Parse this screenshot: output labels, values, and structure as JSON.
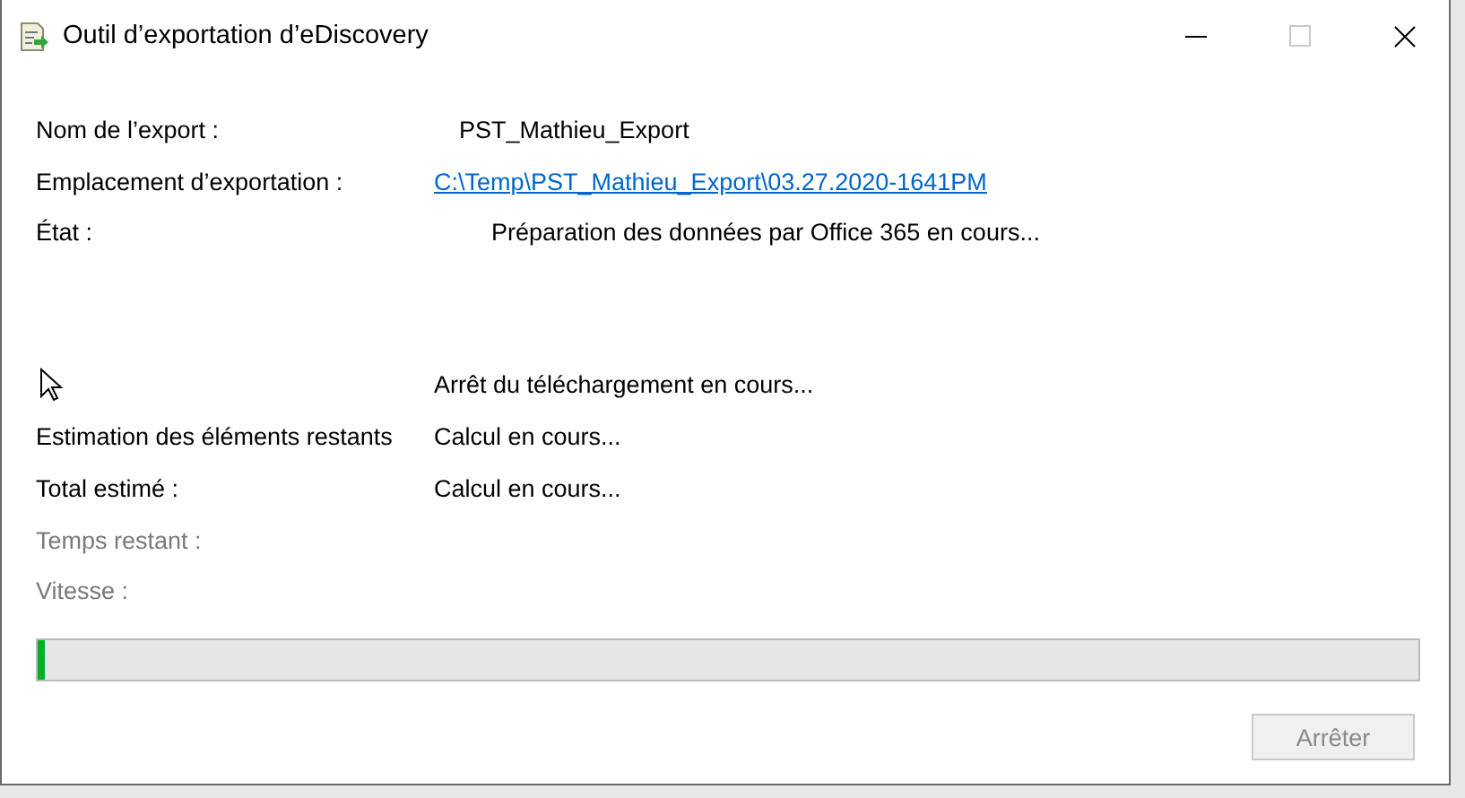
{
  "window": {
    "title": "Outil d’exportation d’eDiscovery"
  },
  "details": [
    {
      "label": "Nom de l’export :",
      "value": "PST_Mathieu_Export",
      "kind": "text"
    },
    {
      "label": "Emplacement d’exportation :",
      "value": "C:\\Temp\\PST_Mathieu_Export\\03.27.2020-1641PM",
      "kind": "link"
    },
    {
      "label": "État :",
      "value": "Préparation des données par Office 365 en cours...",
      "kind": "status"
    }
  ],
  "message": "Arrêt du téléchargement en cours...",
  "metrics": [
    {
      "label": "Estimation des éléments restants",
      "value": "Calcul en cours...",
      "disabled": false
    },
    {
      "label": "Total estimé :",
      "value": "Calcul en cours...",
      "disabled": false
    },
    {
      "label": "Temps restant :",
      "disabled": true
    },
    {
      "label": "Vitesse :",
      "disabled": true
    }
  ],
  "progress": {
    "level": 0.005
  },
  "stop_button": {
    "label": "Arrêter",
    "disabled": true
  }
}
